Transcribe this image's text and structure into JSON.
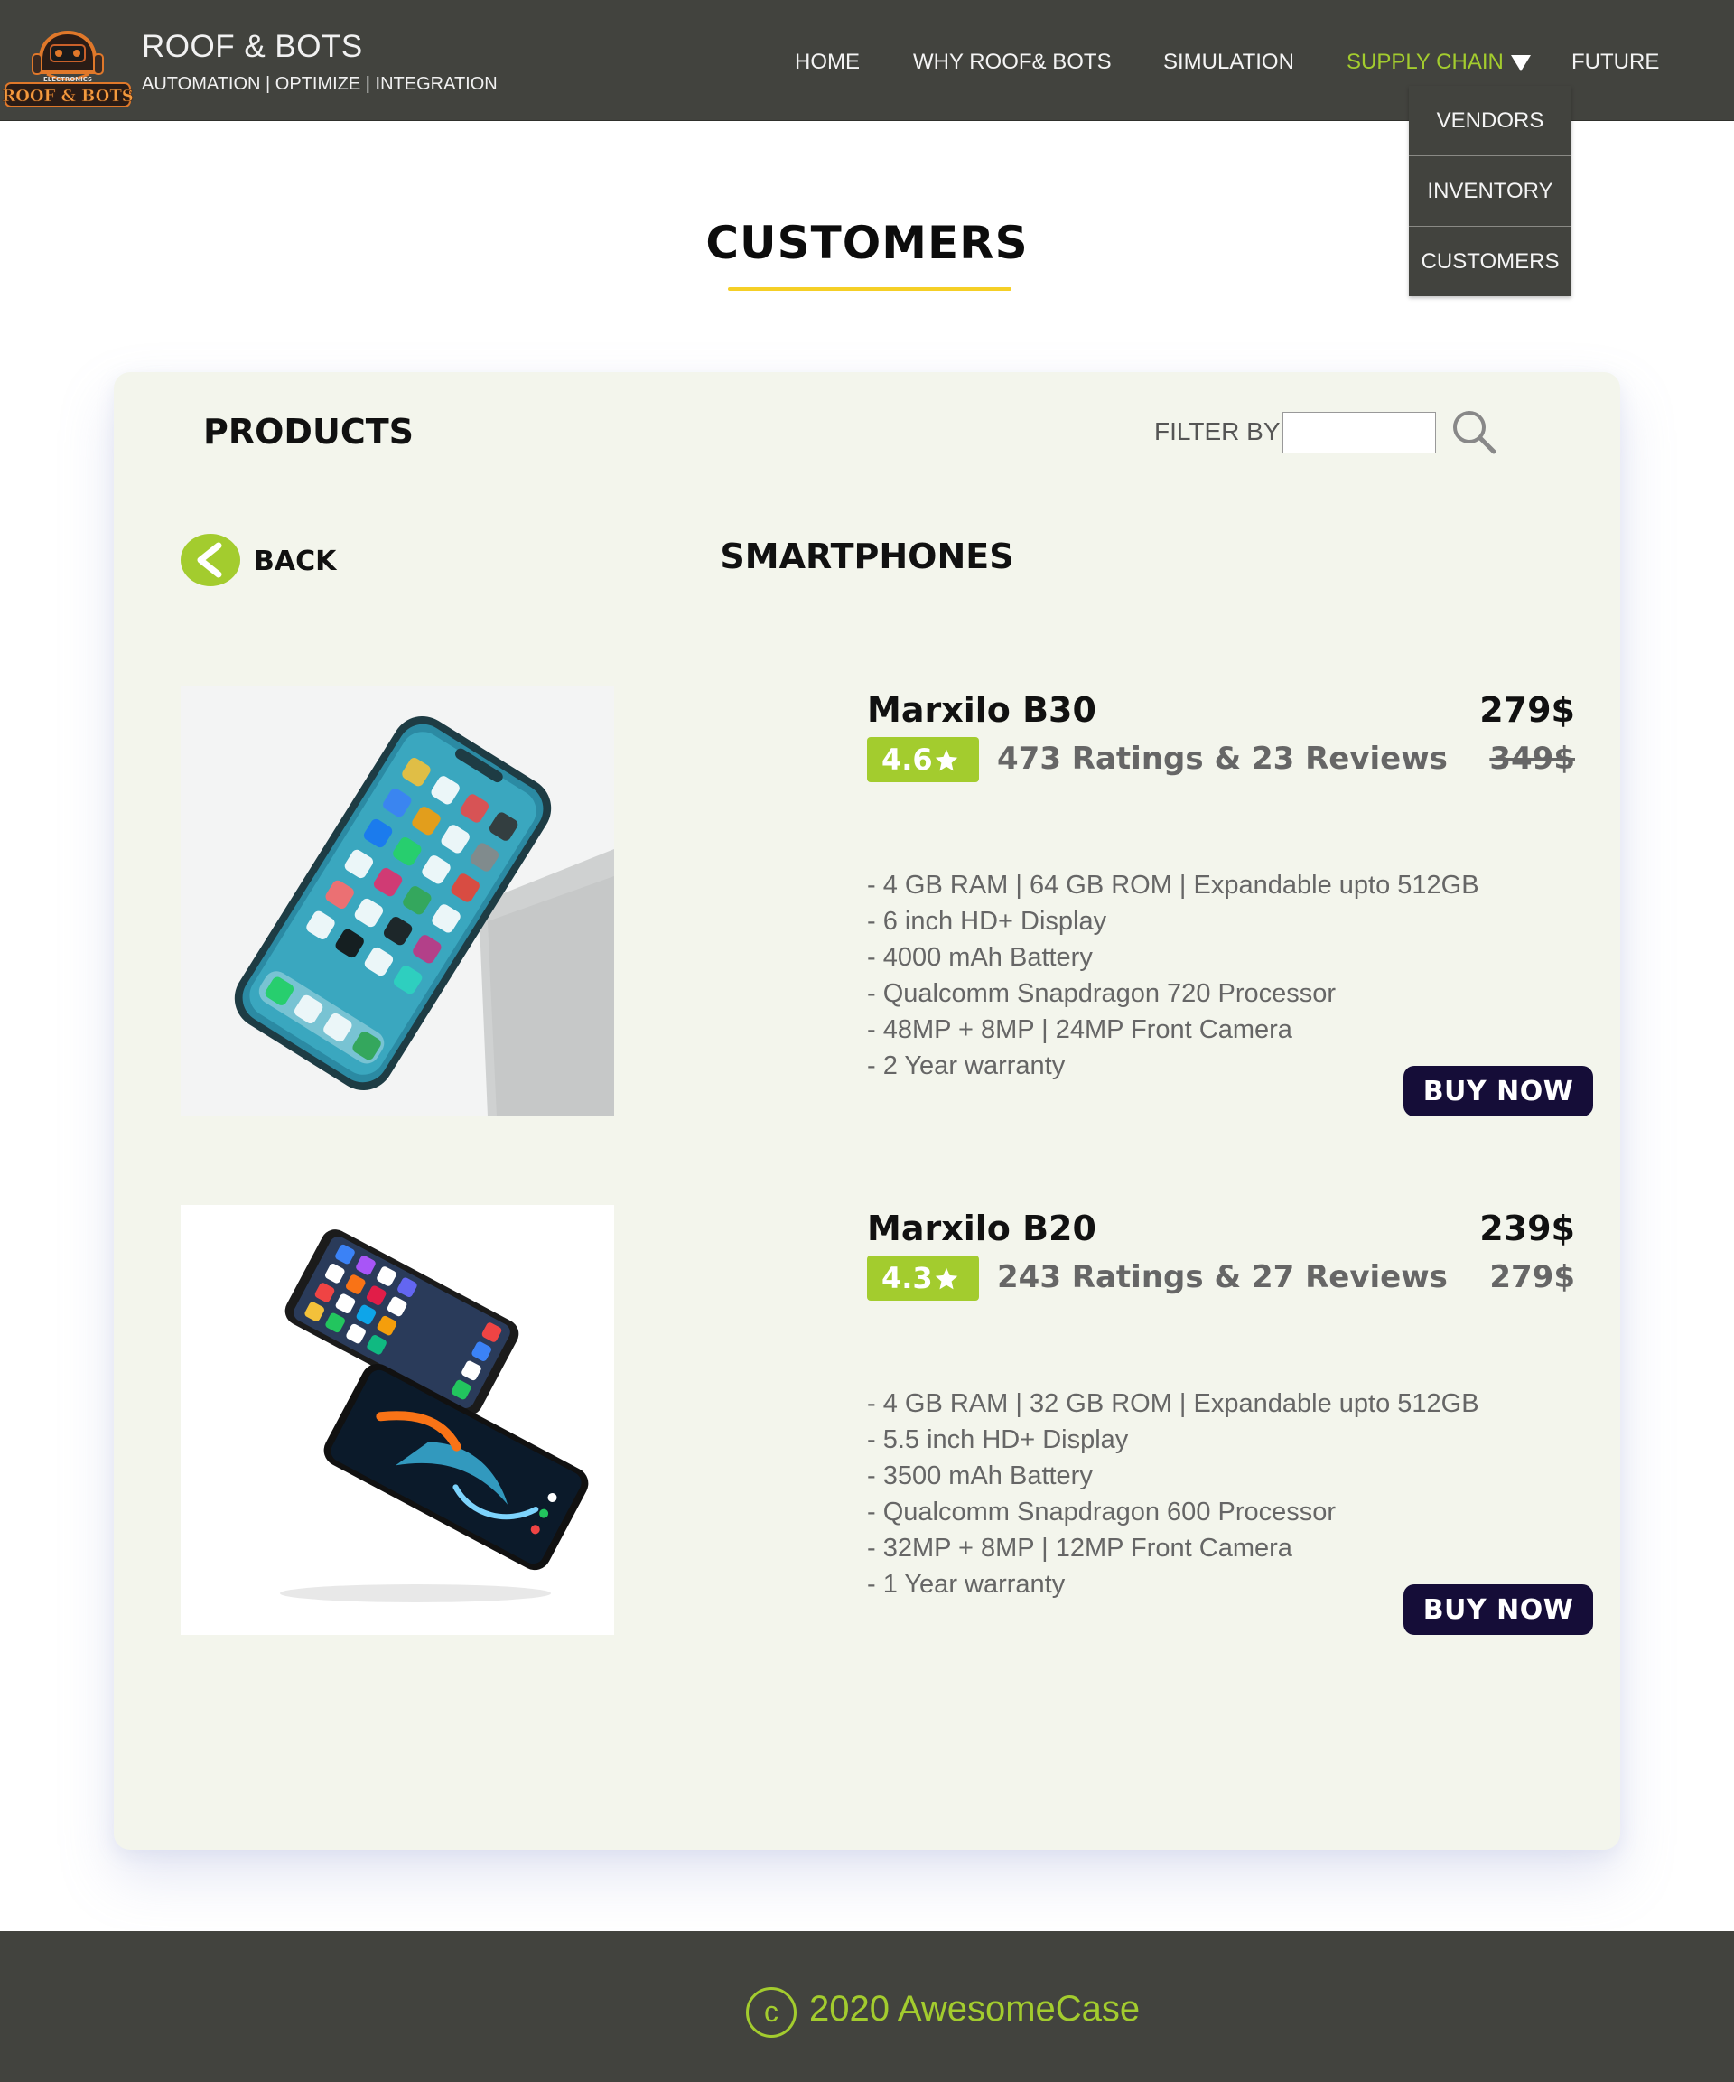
{
  "header": {
    "brand_name": "ROOF & BOTS",
    "tagline": "AUTOMATION | OPTIMIZE | INTEGRATION",
    "logo_text_top": "ELECTRONICS",
    "logo_text_main": "ROOF & BOTS",
    "nav": [
      {
        "label": "HOME"
      },
      {
        "label": "WHY ROOF& BOTS"
      },
      {
        "label": "SIMULATION"
      },
      {
        "label": "SUPPLY CHAIN",
        "active": true
      },
      {
        "label": "FUTURE"
      }
    ],
    "dropdown": [
      "VENDORS",
      "INVENTORY",
      "CUSTOMERS"
    ]
  },
  "page": {
    "title": "CUSTOMERS"
  },
  "products_panel": {
    "heading": "PRODUCTS",
    "filter_label": "FILTER BY",
    "filter_value": "",
    "back_label": "BACK",
    "category": "SMARTPHONES",
    "items": [
      {
        "name": "Marxilo B30",
        "price": "279$",
        "old_price": "349$",
        "old_price_struck": true,
        "rating": "4.6",
        "ratings_text": "473 Ratings & 23 Reviews",
        "specs": [
          "- 4 GB RAM | 64 GB ROM | Expandable upto 512GB",
          "- 6 inch HD+ Display",
          "- 4000 mAh Battery",
          "- Qualcomm Snapdragon 720 Processor",
          "- 48MP + 8MP | 24MP Front Camera",
          "- 2 Year warranty"
        ],
        "buy_label": "BUY NOW"
      },
      {
        "name": "Marxilo B20",
        "price": "239$",
        "old_price": "279$",
        "old_price_struck": false,
        "rating": "4.3",
        "ratings_text": "243 Ratings & 27 Reviews",
        "specs": [
          "- 4 GB RAM | 32 GB ROM | Expandable upto 512GB",
          "- 5.5 inch HD+ Display",
          "- 3500 mAh Battery",
          "- Qualcomm Snapdragon 600 Processor",
          "- 32MP + 8MP | 12MP Front Camera",
          "- 1 Year warranty"
        ],
        "buy_label": "BUY NOW"
      }
    ]
  },
  "footer": {
    "copyright_symbol": "c",
    "text": "2020 AwesomeCase"
  },
  "colors": {
    "header_bg": "#42433e",
    "accent_green": "#a3cc2e",
    "title_underline": "#f5cf26",
    "card_bg": "#f3f5ec",
    "buy_button": "#150d38"
  },
  "icons": {
    "search": "search-icon",
    "back": "back-arrow-icon",
    "star": "star-icon",
    "caret": "caret-down-icon",
    "copyright": "copyright-icon"
  }
}
